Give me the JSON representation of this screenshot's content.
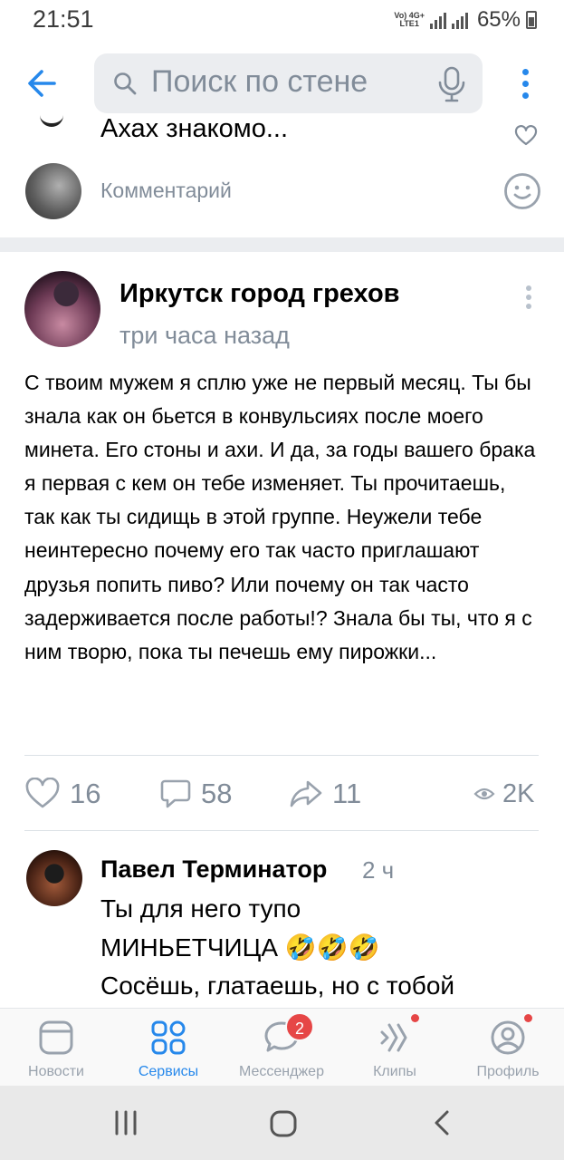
{
  "status": {
    "time": "21:51",
    "network_top": "Vo) 4G+",
    "network_bottom": "LTE1",
    "battery": "65%"
  },
  "header": {
    "search_placeholder": "Поиск по стене"
  },
  "prev_comment": {
    "text": "Ахах знакомо..."
  },
  "comment_input": {
    "placeholder": "Комментарий"
  },
  "post": {
    "author": "Иркутск город грехов",
    "time": "три часа назад",
    "text": "С твоим мужем я сплю уже не первый месяц. Ты бы знала как он бьется в конвульсиях после моего минета. Его стоны и ахи. И да, за годы вашего брака я первая с кем он тебе изменяет. Ты прочитаешь, так как ты сидищь в этой группе. Неужели тебе неинтересно почему его так часто приглашают друзья попить пиво? Или почему он так часто задерживается после работы!? Знала бы ты, что я с ним творю, пока ты печешь ему пирожки...",
    "likes": "16",
    "comments": "58",
    "shares": "11",
    "views": "2K"
  },
  "comment": {
    "author": "Павел Терминатор",
    "time": "2 ч",
    "line1": "Ты для него тупо",
    "line2": "МИНЬЕТЧИЦА 🤣🤣🤣",
    "line3": "Сосёшь, глатаешь, но с тобой"
  },
  "tabs": {
    "news": "Новости",
    "services": "Сервисы",
    "messenger": "Мессенджер",
    "messenger_badge": "2",
    "clips": "Клипы",
    "profile": "Профиль"
  },
  "colors": {
    "accent": "#2688eb",
    "secondary_text": "#818c99",
    "badge": "#e64646"
  }
}
